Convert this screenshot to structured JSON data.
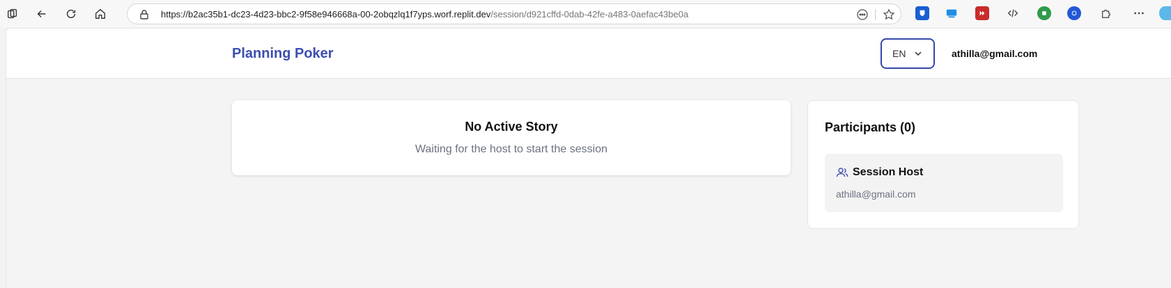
{
  "browser": {
    "url_main": "https://b2ac35b1-dc23-4d23-bbc2-9f58e946668a-00-2obqzlq1f7yps.worf.replit.dev",
    "url_path": "/session/d921cffd-0dab-42fe-a483-0aefac43be0a"
  },
  "header": {
    "brand": "Planning Poker",
    "language": "EN",
    "user_email": "athilla@gmail.com"
  },
  "story": {
    "title": "No Active Story",
    "subtitle": "Waiting for the host to start the session"
  },
  "participants": {
    "title": "Participants (0)",
    "host_label": "Session Host",
    "host_email": "athilla@gmail.com"
  },
  "colors": {
    "accent": "#3b4fb0"
  }
}
